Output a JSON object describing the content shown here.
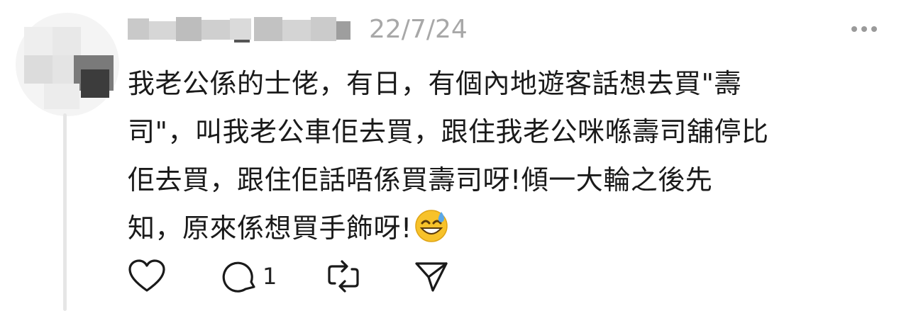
{
  "post": {
    "timestamp": "22/7/24",
    "lines": [
      "我老公係的士佬，有日，有個內地遊客話想去買\"壽",
      "司\"，叫我老公車佢去買，跟住我老公咪喺壽司舖停比",
      "佢去買，跟住佢話唔係買壽司呀!傾一大輪之後先",
      "知，原來係想買手飾呀!"
    ],
    "emoji": "sweat-smile-emoji"
  },
  "actions": {
    "like_icon": "heart-icon",
    "reply_icon": "comment-icon",
    "reply_count": "1",
    "repost_icon": "repost-icon",
    "share_icon": "send-icon"
  },
  "colors": {
    "icon": "#1a1a1a",
    "muted": "#a8a8a8",
    "thread_line": "#e6e6e6"
  }
}
